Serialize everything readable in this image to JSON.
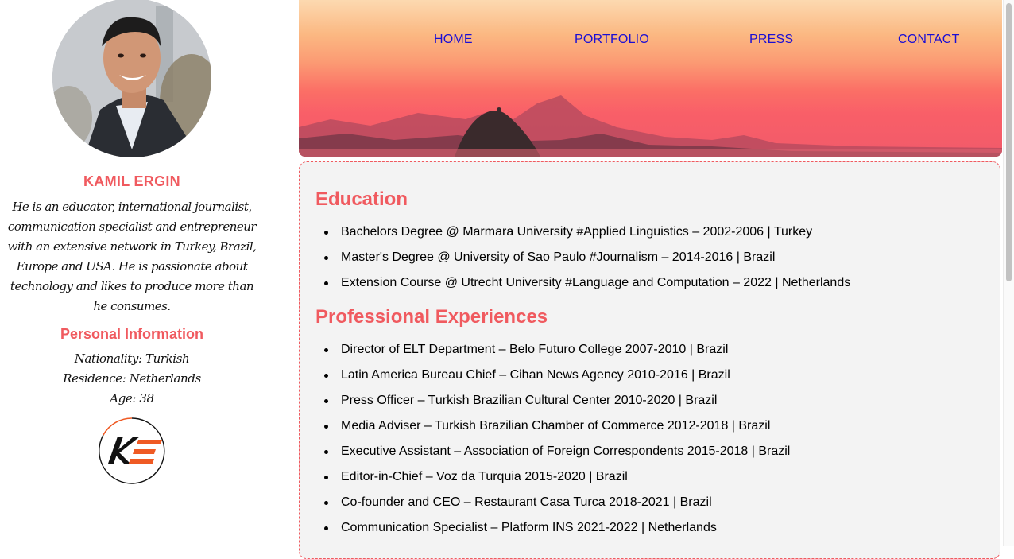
{
  "profile": {
    "name": "KAMIL ERGIN",
    "bio": "He is an educator, international journalist, communication specialist and entrepreneur with an extensive network in Turkey, Brazil, Europe and USA. He is passionate about technology and likes to produce more than he consumes.",
    "personal_title": "Personal Information",
    "nationality": "Nationality: Turkish",
    "residence": "Residence: Netherlands",
    "age": "Age: 38",
    "logo_icon": "ke-logo-icon"
  },
  "nav": {
    "items": [
      "HOME",
      "PORTFOLIO",
      "PRESS",
      "CONTACT"
    ],
    "color": "#1a0dd4"
  },
  "education": {
    "title": "Education",
    "items": [
      "Bachelors Degree @ Marmara University #Applied Linguistics – 2002-2006 | Turkey",
      "Master's Degree @ University of Sao Paulo #Journalism – 2014-2016 | Brazil",
      "Extension Course @ Utrecht University #Language and Computation – 2022 | Netherlands"
    ]
  },
  "experience": {
    "title": "Professional Experiences",
    "items": [
      "Director of ELT Department – Belo Futuro College 2007-2010 | Brazil",
      "Latin America Bureau Chief – Cihan News Agency 2010-2016 | Brazil",
      "Press Officer – Turkish Brazilian Cultural Center 2010-2020 | Brazil",
      "Media Adviser – Turkish Brazilian Chamber of Commerce 2012-2018 | Brazil",
      "Executive Assistant – Association of Foreign Correspondents 2015-2018 | Brazil",
      "Editor-in-Chief – Voz da Turquia 2015-2020 | Brazil",
      "Co-founder and CEO – Restaurant Casa Turca 2018-2021 | Brazil",
      "Communication Specialist – Platform INS 2021-2022 | Netherlands"
    ]
  },
  "colors": {
    "accent": "#f05a5f",
    "card_bg": "#f3f3f3"
  }
}
